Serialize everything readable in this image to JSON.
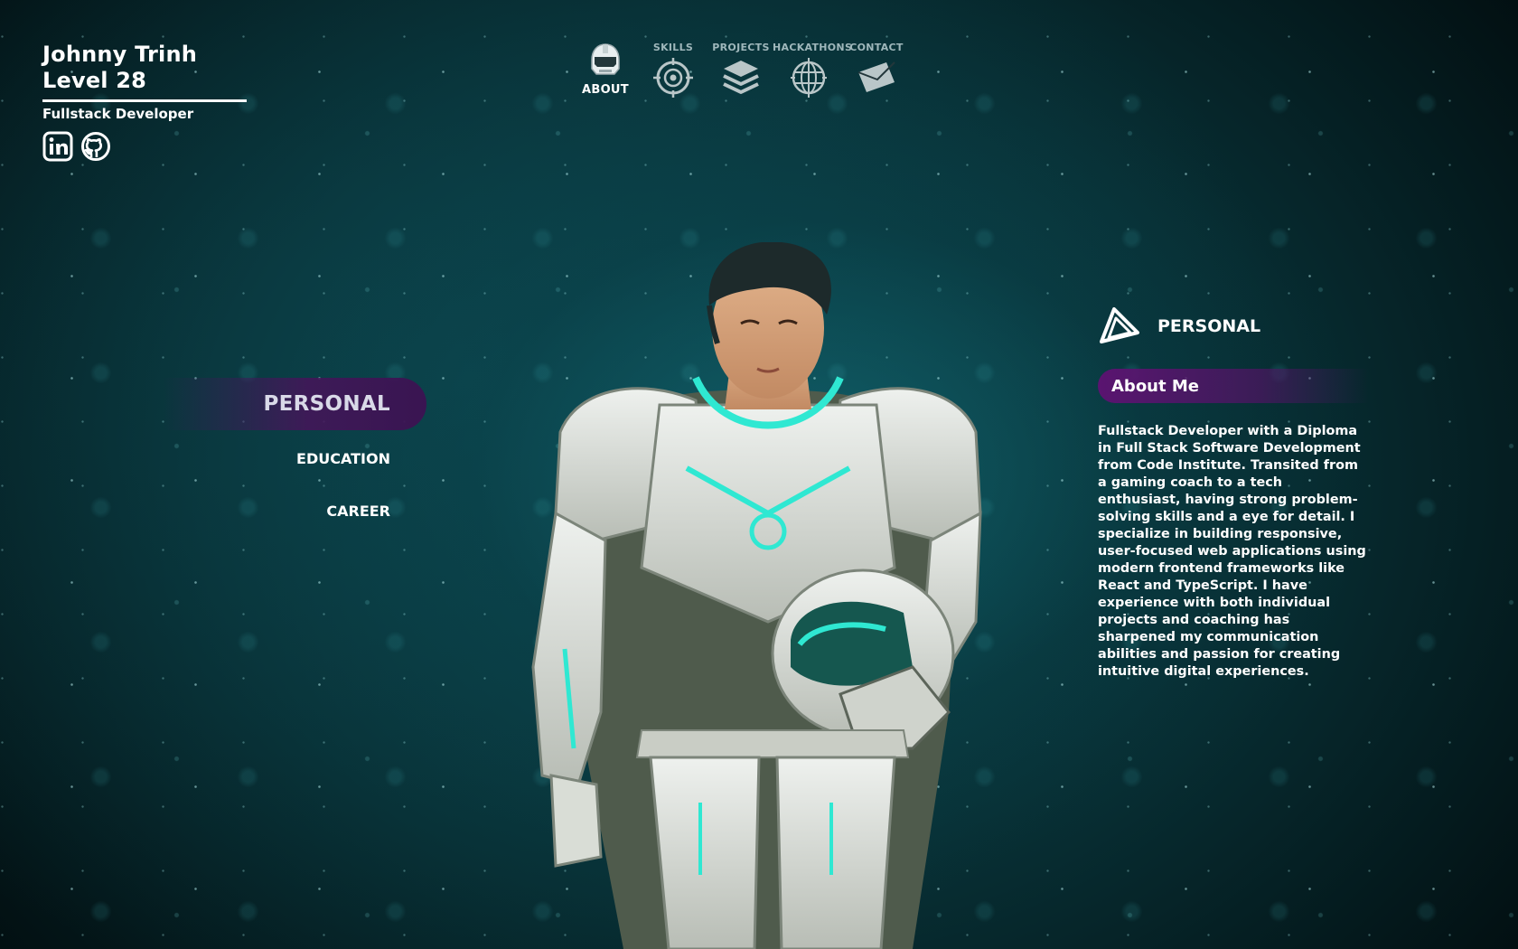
{
  "profile": {
    "name": "Johnny Trinh",
    "level": "Level 28",
    "role": "Fullstack Developer",
    "socials": [
      {
        "icon": "linkedin-icon"
      },
      {
        "icon": "github-icon"
      }
    ]
  },
  "nav": {
    "items": [
      {
        "label": "ABOUT",
        "icon": "helmet-icon",
        "active": true
      },
      {
        "label": "SKILLS",
        "icon": "target-icon",
        "active": false
      },
      {
        "label": "PROJECTS",
        "icon": "layers-icon",
        "active": false
      },
      {
        "label": "HACKATHONS",
        "icon": "globe-icon",
        "active": false
      },
      {
        "label": "CONTACT",
        "icon": "envelope-icon",
        "active": false
      }
    ]
  },
  "subnav": {
    "items": [
      {
        "label": "PERSONAL",
        "active": true
      },
      {
        "label": "EDUCATION",
        "active": false
      },
      {
        "label": "CAREER",
        "active": false
      }
    ]
  },
  "panel": {
    "heading_icon": "triangle-logo-icon",
    "heading": "PERSONAL",
    "section_title": "About Me",
    "body": "Fullstack Developer with a Diploma in Full Stack Software Development from Code Institute. Transited from a gaming coach to a tech enthusiast, having strong problem-solving skills and a eye for detail. I specialize in building responsive, user-focused web applications using modern frontend frameworks like React and TypeScript. I have experience with both individual projects and coaching has sharpened my communication abilities and passion for creating intuitive digital experiences."
  },
  "colors": {
    "accent_purple": "#5a1470",
    "accent_teal": "#2fe8d2",
    "background": "#0c4a52"
  }
}
